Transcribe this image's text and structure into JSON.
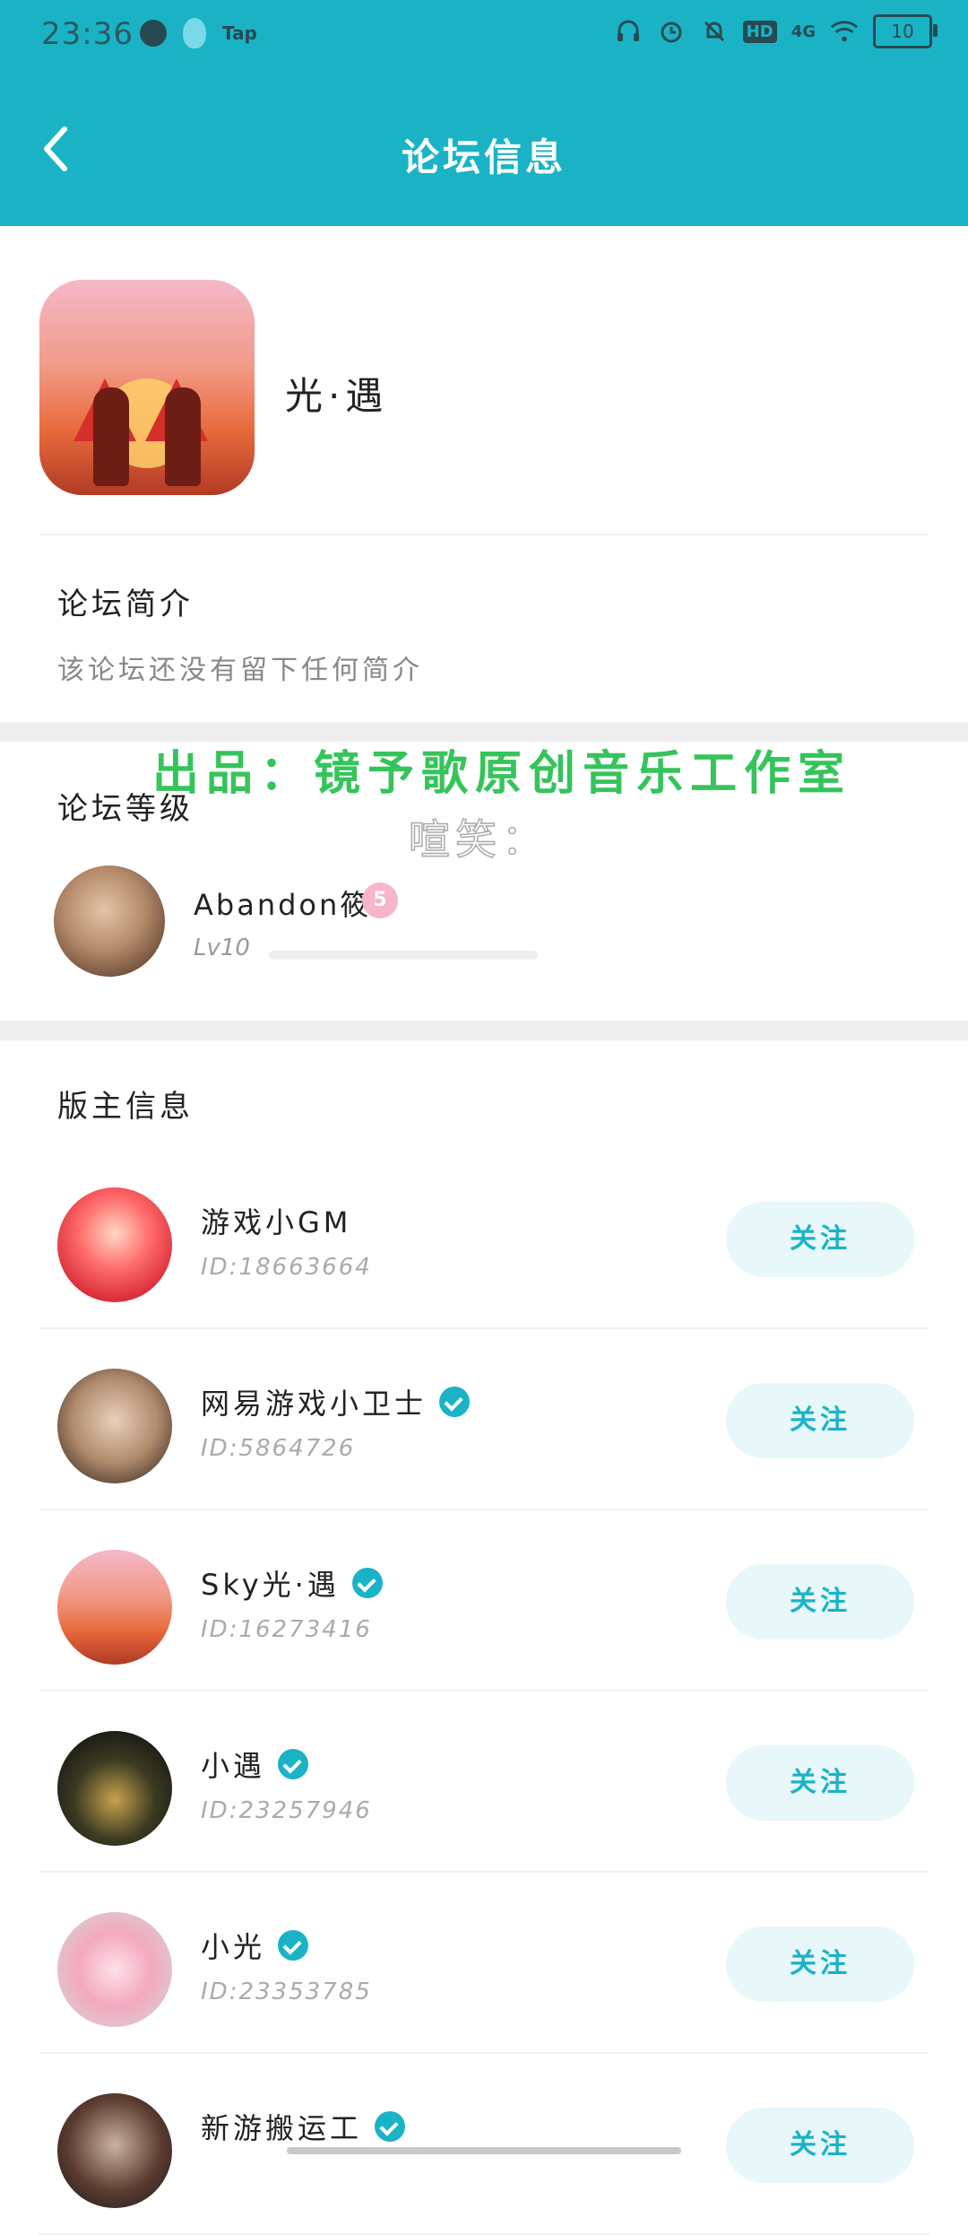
{
  "status_bar": {
    "time": "23:36",
    "left_icons": [
      "earth-icon",
      "qq-icon"
    ],
    "tap_label": "Tap",
    "hd_label": "HD",
    "network_label": "4G",
    "battery_level": "10"
  },
  "header": {
    "title": "论坛信息",
    "back_icon": "chevron-left-icon",
    "color": "#1ab3c6"
  },
  "forum": {
    "name": "光·遇"
  },
  "intro": {
    "title": "论坛简介",
    "text": "该论坛还没有留下任何简介"
  },
  "overlay": {
    "green_text": "出品：镜予歌原创音乐工作室",
    "gray_text": "喧笑："
  },
  "level": {
    "title": "论坛等级",
    "user_name": "Abandon筱.",
    "badge": "5",
    "level_label": "Lv10",
    "progress_fraction": 0.0
  },
  "moderators": {
    "title": "版主信息",
    "follow_label": "关注",
    "items": [
      {
        "name": "游戏小GM",
        "id": "ID:18663664",
        "verified": false
      },
      {
        "name": "网易游戏小卫士",
        "id": "ID:5864726",
        "verified": true
      },
      {
        "name": "Sky光·遇",
        "id": "ID:16273416",
        "verified": true
      },
      {
        "name": "小遇",
        "id": "ID:23257946",
        "verified": true
      },
      {
        "name": "小光",
        "id": "ID:23353785",
        "verified": true
      },
      {
        "name": "新游搬运工",
        "id": "",
        "verified": true
      }
    ]
  }
}
